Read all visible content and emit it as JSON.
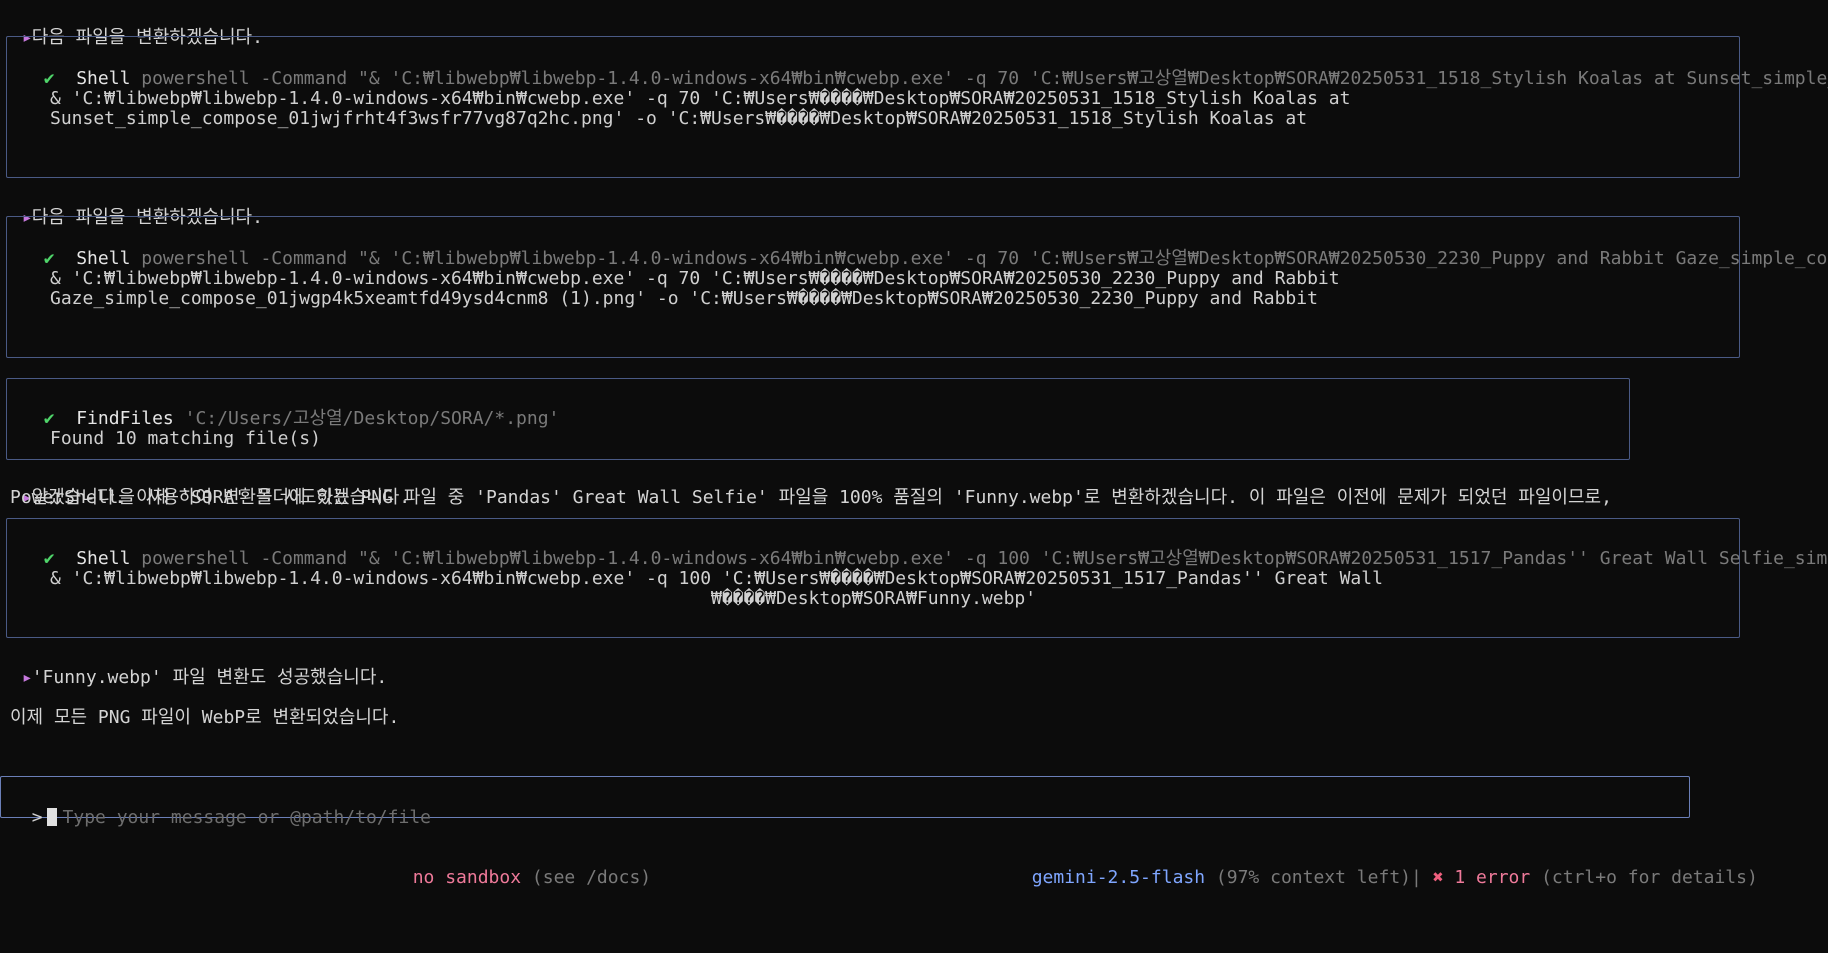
{
  "messages": {
    "m1": "다음 파일을 변환하겠습니다.",
    "m2": "다음 파일을 변환하겠습니다.",
    "m3_line1": "알겠습니다. 이제 'SORA' 폴더에 있는 PNG 파일 중 'Pandas' Great Wall Selfie' 파일을 100% 품질의 'Funny.webp'로 변환하겠습니다. 이 파일은 이전에 문제가 되었던 파일이므로,",
    "m3_line2": "PowerShell을 사용하여 변환을 시도하겠습니다.",
    "m4": "'Funny.webp' 파일 변환도 성공했습니다.",
    "m5": "이제 모든 PNG 파일이 WebP로 변환되었습니다."
  },
  "tools": [
    {
      "status_icon": "✔",
      "name": "Shell",
      "desc": "powershell -Command \"& 'C:₩libwebp₩libwebp-1.4.0-windows-x64₩bin₩cwebp.exe' -q 70 'C:₩Users₩고상열₩Desktop₩SORA₩20250531_1518_Stylish Koalas at Sunset_simple_co…",
      "output_line1": "& 'C:₩libwebp₩libwebp-1.4.0-windows-x64₩bin₩cwebp.exe' -q 70 'C:₩Users₩����₩Desktop₩SORA₩20250531_1518_Stylish Koalas at",
      "output_line2": "Sunset_simple_compose_01jwjfrht4f3wsfr77vg87q2hc.png' -o 'C:₩Users₩����₩Desktop₩SORA₩20250531_1518_Stylish Koalas at"
    },
    {
      "status_icon": "✔",
      "name": "Shell",
      "desc": "powershell -Command \"& 'C:₩libwebp₩libwebp-1.4.0-windows-x64₩bin₩cwebp.exe' -q 70 'C:₩Users₩고상열₩Desktop₩SORA₩20250530_2230_Puppy and Rabbit Gaze_simple_compo…",
      "output_line1": "& 'C:₩libwebp₩libwebp-1.4.0-windows-x64₩bin₩cwebp.exe' -q 70 'C:₩Users₩����₩Desktop₩SORA₩20250530_2230_Puppy and Rabbit",
      "output_line2": "Gaze_simple_compose_01jwgp4k5xeamtfd49ysd4cnm8 (1).png' -o 'C:₩Users₩����₩Desktop₩SORA₩20250530_2230_Puppy and Rabbit"
    },
    {
      "status_icon": "✔",
      "name": "FindFiles",
      "desc": "'C:/Users/고상열/Desktop/SORA/*.png'",
      "output_line1": "Found 10 matching file(s)"
    },
    {
      "status_icon": "✔",
      "name": "Shell",
      "desc": "powershell -Command \"& 'C:₩libwebp₩libwebp-1.4.0-windows-x64₩bin₩cwebp.exe' -q 100 'C:₩Users₩고상열₩Desktop₩SORA₩20250531_1517_Pandas'' Great Wall Selfie_simple…",
      "output_line1": "& 'C:₩libwebp₩libwebp-1.4.0-windows-x64₩bin₩cwebp.exe' -q 100 'C:₩Users₩����₩Desktop₩SORA₩20250531_1517_Pandas'' Great Wall",
      "output_line2": "₩����₩Desktop₩SORA₩Funny.webp'"
    }
  ],
  "input": {
    "prompt": ">",
    "placeholder": "Type your message or @path/to/file"
  },
  "footer": {
    "sandbox": "no sandbox",
    "sandbox_hint": "(see /docs)",
    "model": "gemini-2.5-flash",
    "context": "(97% context left)",
    "separator": "|",
    "error_icon": "✖",
    "error_text": "1 error",
    "error_hint": "(ctrl+o for details)"
  },
  "colors": {
    "background": "#0c0c0c",
    "border": "#4a5a85",
    "check": "#4fd46a",
    "accent_pink": "#ef7a9a",
    "accent_blue": "#7fa6ff"
  }
}
